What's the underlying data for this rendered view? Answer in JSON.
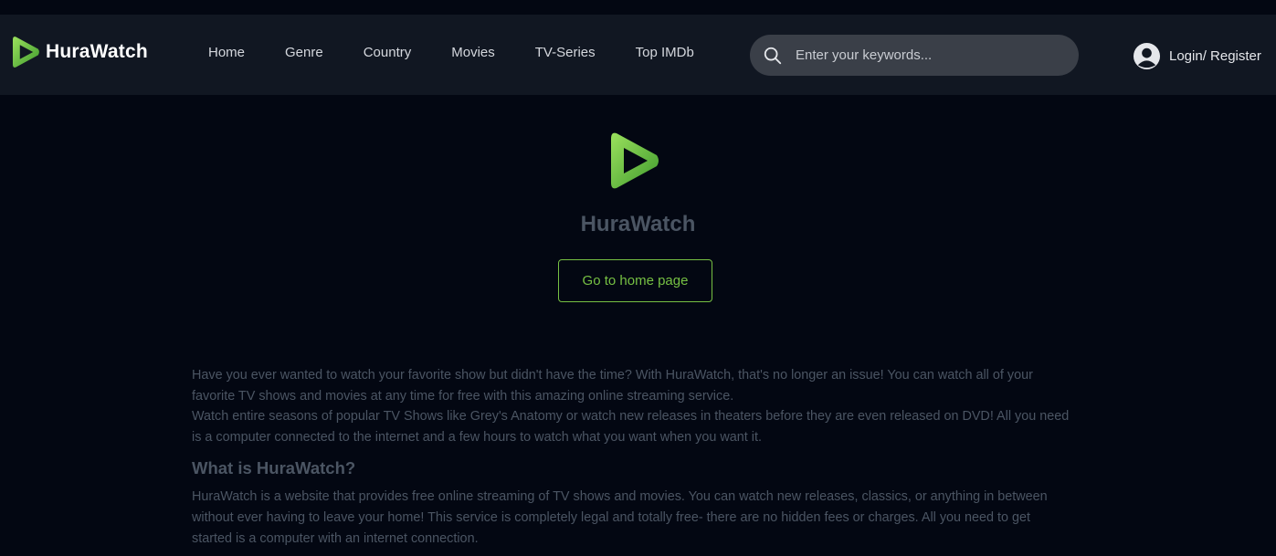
{
  "header": {
    "brand": "HuraWatch",
    "nav": [
      "Home",
      "Genre",
      "Country",
      "Movies",
      "TV-Series",
      "Top IMDb"
    ],
    "search_placeholder": "Enter your keywords...",
    "login_label": "Login/ Register"
  },
  "hero": {
    "title": "HuraWatch",
    "button_label": "Go to home page"
  },
  "content": {
    "p1": "Have you ever wanted to watch your favorite show but didn't have the time? With HuraWatch, that's no longer an issue! You can watch all of your favorite TV shows and movies at any time for free with this amazing online streaming service.",
    "p2": "Watch entire seasons of popular TV Shows like Grey's Anatomy or watch new releases in theaters before they are even released on DVD! All you need is a computer connected to the internet and a few hours to watch what you want when you want it.",
    "h2": "What is HuraWatch?",
    "p3": "HuraWatch is a website that provides free online streaming of TV shows and movies. You can watch new releases, classics, or anything in between without ever having to leave your home! This service is completely legal and totally free- there are no hidden fees or charges. All you need to get started is a computer with an internet connection."
  },
  "icons": {
    "logo": "play-logo-icon",
    "search": "search-icon",
    "user": "user-avatar-icon"
  },
  "colors": {
    "accent": "#76c043",
    "background": "#030712",
    "header": "#111722"
  }
}
